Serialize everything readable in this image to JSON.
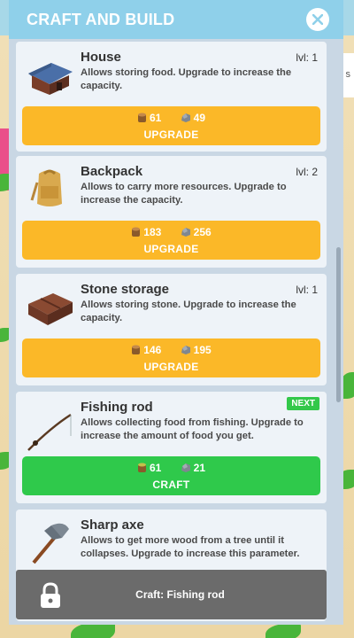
{
  "header": {
    "title": "CRAFT AND BUILD"
  },
  "cards": [
    {
      "title": "House",
      "level": "lvl: 1",
      "description": "Allows storing food. Upgrade to increase the capacity.",
      "wood": "61",
      "stone": "49",
      "action": "UPGRADE",
      "icon": "house-icon"
    },
    {
      "title": "Backpack",
      "level": "lvl: 2",
      "description": "Allows to carry more resources. Upgrade to increase the capacity.",
      "wood": "183",
      "stone": "256",
      "action": "UPGRADE",
      "icon": "backpack-icon"
    },
    {
      "title": "Stone storage",
      "level": "lvl: 1",
      "description": "Allows storing stone. Upgrade to increase the capacity.",
      "wood": "146",
      "stone": "195",
      "action": "UPGRADE",
      "icon": "stone-storage-icon"
    },
    {
      "title": "Fishing rod",
      "badge": "NEXT",
      "description": "Allows collecting food from fishing. Upgrade to increase the amount of food you get.",
      "wood": "61",
      "stone": "21",
      "action": "CRAFT",
      "icon": "fishing-rod-icon"
    },
    {
      "title": "Sharp axe",
      "description": "Allows to get more wood from a tree until it collapses. Upgrade to increase this parameter.",
      "icon": "axe-icon"
    }
  ],
  "bottom_bar": {
    "label": "Craft: Fishing rod",
    "icon": "lock-icon"
  },
  "background": {
    "text": "s"
  },
  "colors": {
    "header": "#8fd0ea",
    "upgrade": "#fbb828",
    "craft": "#2fc94b",
    "badge": "#33c84a",
    "bottom_bar": "#6b6b6b"
  }
}
